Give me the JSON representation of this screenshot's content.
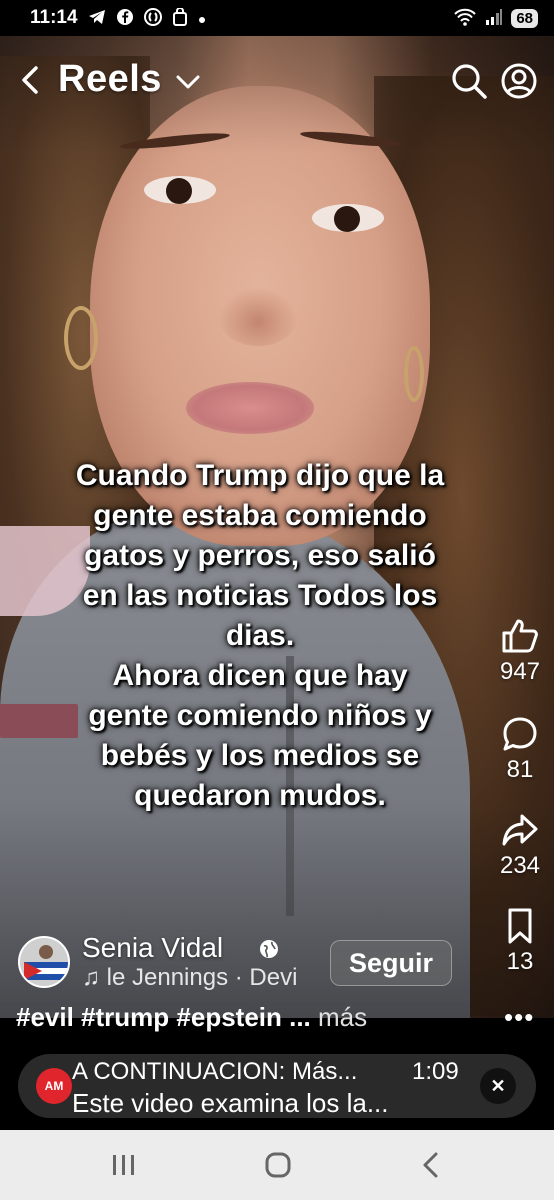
{
  "status_bar": {
    "time": "11:14",
    "battery": "68",
    "icons": [
      "telegram-icon",
      "facebook-icon",
      "shazam-icon",
      "bag-icon",
      "dot-icon",
      "wifi-icon",
      "signal-icon"
    ]
  },
  "header": {
    "title": "Reels"
  },
  "caption": {
    "lines": [
      "Cuando Trump dijo que la",
      "gente estaba comiendo",
      "gatos y perros, eso salió",
      "en las noticias Todos los",
      "dias.",
      "Ahora dicen que hay",
      "gente comiendo niños y",
      "bebés y los medios se",
      "quedaron mudos."
    ]
  },
  "actions": {
    "likes": "947",
    "comments": "81",
    "shares": "234",
    "saves": "13"
  },
  "author": {
    "name": "Senia Vidal",
    "audio": "♫ le Jennings · Devi",
    "follow_label": "Seguir"
  },
  "description": {
    "hashtags": "#evil #trump #epstein ...",
    "more_label": "más"
  },
  "up_next": {
    "logo_text": "AM",
    "label": "A CONTINUACION: Más...",
    "duration": "1:09",
    "title": "Este video examina los la..."
  },
  "colors": {
    "next_logo": "#e0262c",
    "navbar": "#ececec"
  }
}
